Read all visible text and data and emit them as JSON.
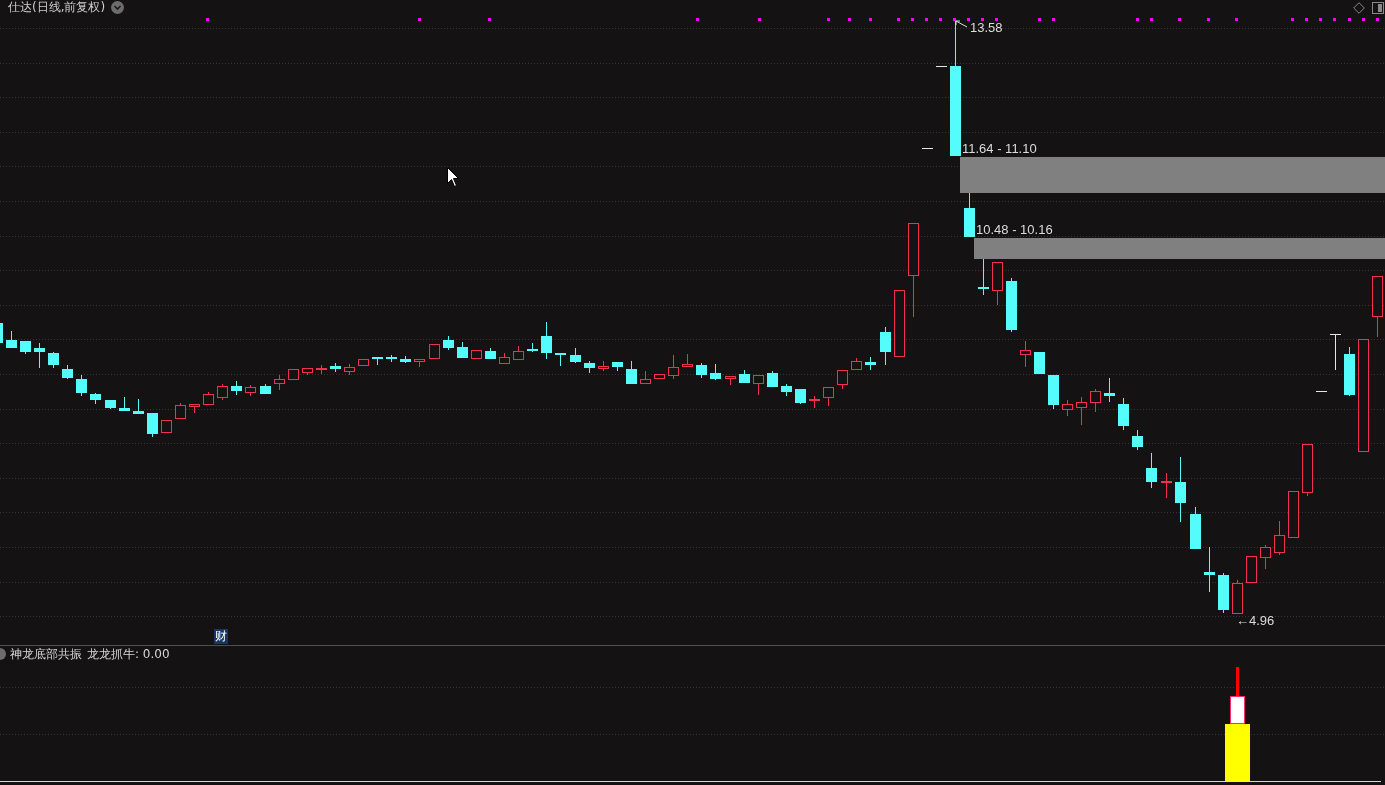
{
  "header": {
    "title": "仕达(日线,前复权)"
  },
  "chart": {
    "high_label": "13.58",
    "low_label": "←4.96",
    "gaps": [
      {
        "label": "11.64 - 11.10"
      },
      {
        "label": "10.48 - 10.16"
      }
    ],
    "event_badge": "财"
  },
  "indicator": {
    "name": "神龙底部共振",
    "reading": "龙龙抓牛: 0.00"
  }
}
